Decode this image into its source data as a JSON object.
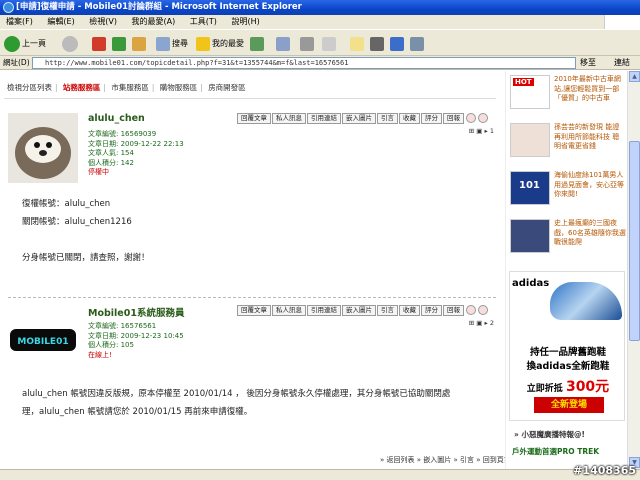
{
  "window": {
    "title": "[申請]復權申請 - Mobile01討論群組 - Microsoft Internet Explorer"
  },
  "menu": [
    "檔案(F)",
    "編輯(E)",
    "檢視(V)",
    "我的最愛(A)",
    "工具(T)",
    "說明(H)"
  ],
  "toolbar": {
    "back": "上一頁",
    "search": "搜尋",
    "favorites": "我的最愛"
  },
  "address": {
    "label": "網址(D)",
    "url": "http://www.mobile01.com/topicdetail.php?f=31&t=1355744&m=f&last=16576561",
    "go": "移至",
    "links": "連結"
  },
  "forum_nav": [
    "檢視分區列表",
    "站務服務區",
    "市集服務區",
    "購物服務區",
    "房商開發區"
  ],
  "post_buttons": [
    "回覆文章",
    "私人訊息",
    "引用連結",
    "嵌入圖片",
    "引言",
    "收藏",
    "評分",
    "回報"
  ],
  "posts": [
    {
      "username": "alulu_chen",
      "meta": [
        "文章編號: 16569039",
        "文章日期: 2009-12-22 22:13",
        "文章人氣: 154",
        "個人積分: 142"
      ],
      "status": "停權中",
      "number": "1",
      "body": [
        "復權帳號：alulu_chen",
        "關閉帳號：alulu_chen1216",
        "",
        "分身帳號已關閉，請查照，謝謝！"
      ]
    },
    {
      "username": "Mobile01系統服務員",
      "meta": [
        "文章編號: 16576561",
        "文章日期: 2009-12-23 10:45",
        "個人積分: 105"
      ],
      "status": "在線上!",
      "number": "2",
      "body": [
        "alulu_chen 帳號因違反版規，原本停權至 2010/01/14 ， 後因分身帳號永久停權處理，其分身帳號已協助關閉處",
        "理，alulu_chen 帳號請您於 2010/01/15 再前來申請復權。"
      ]
    }
  ],
  "bottom_links": "» 返回列表 » 嵌入圖片 » 引言 » 回到頁首",
  "sidebar_ads": [
    {
      "text": "2010年最新中古車網站,讓您輕鬆買到一部「優質」的中古車",
      "label": "HOT"
    },
    {
      "text": "孫芸芸的新發現 能證再利用所節能科技 聰明省電更省錢"
    },
    {
      "text": "海偷仙度絲101萬男人用過見面會，安心亞等你來閱!",
      "label": "101"
    },
    {
      "text": "史上最瘋癲的三國夜戲，60名英雄隨你我選戰很能爬"
    }
  ],
  "big_ad": {
    "brand": "adidas",
    "line1": "持任一品牌舊跑鞋",
    "line2": "換adidas全新跑鞋",
    "line3_prefix": "立即折抵",
    "price": "300元",
    "badge": "全新登場"
  },
  "sidebar_links": [
    "» 小惡魔廣播特報@!",
    "戶外運動首選PRO TREK"
  ],
  "watermark": "#1408365"
}
